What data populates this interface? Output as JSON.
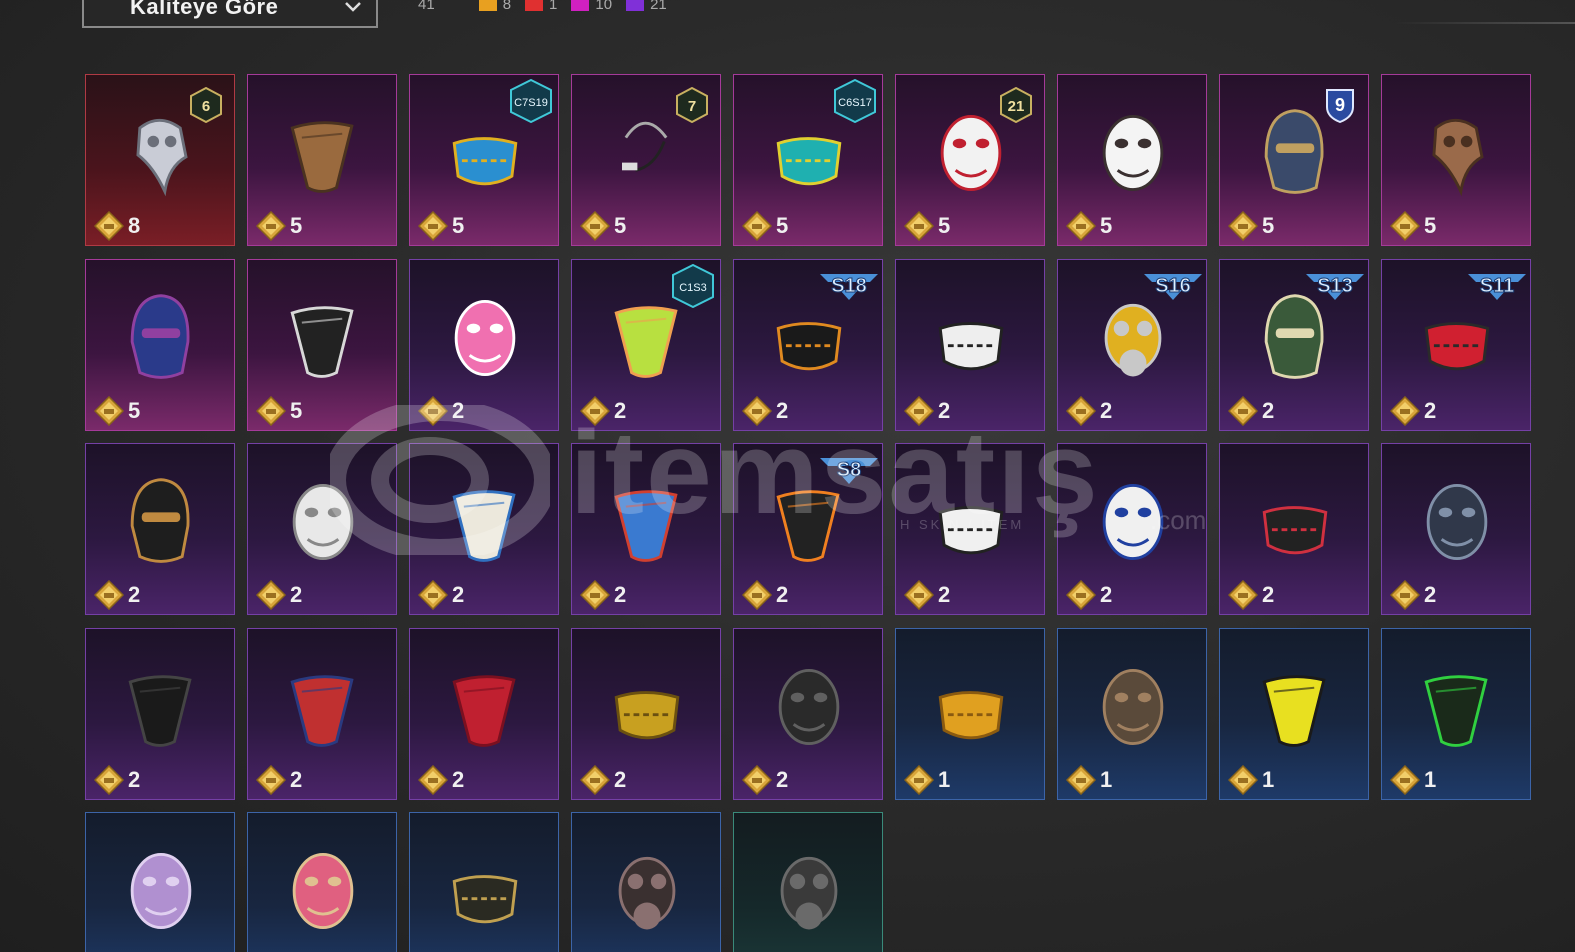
{
  "header": {
    "sort_label": "Kaliteye Göre",
    "total_count": "41",
    "rarity_counts": [
      {
        "color": "#e8a020",
        "value": "8"
      },
      {
        "color": "#e03030",
        "value": "1"
      },
      {
        "color": "#d020c0",
        "value": "10"
      },
      {
        "color": "#8030d8",
        "value": "21"
      }
    ]
  },
  "watermark": {
    "text": "itemsatış",
    "sub": "H SKIN / ITEM",
    "suffix": ".com"
  },
  "items": [
    {
      "price": "8",
      "rarity": "red",
      "badge": "6",
      "badge_type": "num",
      "icon": "plague-doctor-mask-icon"
    },
    {
      "price": "5",
      "rarity": "pink",
      "icon": "brown-bandana-icon"
    },
    {
      "price": "5",
      "rarity": "pink",
      "badge": "C7S19",
      "badge_type": "hex",
      "icon": "aztec-face-mask-icon"
    },
    {
      "price": "5",
      "rarity": "pink",
      "badge": "7",
      "badge_type": "num",
      "icon": "headset-mic-icon"
    },
    {
      "price": "5",
      "rarity": "pink",
      "badge": "C6S17",
      "badge_type": "hex",
      "icon": "teal-face-mask-icon"
    },
    {
      "price": "5",
      "rarity": "pink",
      "badge": "21",
      "badge_type": "num",
      "icon": "joker-mask-icon"
    },
    {
      "price": "5",
      "rarity": "pink",
      "icon": "white-cloth-mask-icon"
    },
    {
      "price": "5",
      "rarity": "pink",
      "badge": "9",
      "badge_type": "shield",
      "icon": "knight-helmet-icon"
    },
    {
      "price": "5",
      "rarity": "pink",
      "icon": "bronze-beak-mask-icon"
    },
    {
      "price": "5",
      "rarity": "pink",
      "icon": "galaxy-helmet-icon"
    },
    {
      "price": "5",
      "rarity": "pink",
      "icon": "skull-bandana-icon"
    },
    {
      "price": "2",
      "rarity": "purple",
      "icon": "pink-cartoon-mask-icon"
    },
    {
      "price": "2",
      "rarity": "purple",
      "badge": "C1S3",
      "badge_type": "hex",
      "icon": "cactus-bandana-icon"
    },
    {
      "price": "2",
      "rarity": "purple",
      "badge": "S18",
      "badge_type": "season",
      "icon": "heartbeat-mask-icon"
    },
    {
      "price": "2",
      "rarity": "purple",
      "icon": "skull-face-mask-icon"
    },
    {
      "price": "2",
      "rarity": "purple",
      "badge": "S16",
      "badge_type": "season",
      "icon": "visor-respirator-icon"
    },
    {
      "price": "2",
      "rarity": "purple",
      "badge": "S13",
      "badge_type": "season",
      "icon": "goggle-helmet-icon"
    },
    {
      "price": "2",
      "rarity": "purple",
      "badge": "S11",
      "badge_type": "season",
      "icon": "red-half-mask-icon"
    },
    {
      "price": "2",
      "rarity": "purple",
      "icon": "ninja-hood-icon"
    },
    {
      "price": "2",
      "rarity": "purple",
      "icon": "bandage-mask-icon"
    },
    {
      "price": "2",
      "rarity": "purple",
      "icon": "white-bandana-icon"
    },
    {
      "price": "2",
      "rarity": "purple",
      "icon": "blue-bandana-icon"
    },
    {
      "price": "2",
      "rarity": "purple",
      "badge": "S8",
      "badge_type": "season",
      "icon": "flame-bandana-icon"
    },
    {
      "price": "2",
      "rarity": "purple",
      "icon": "skull-print-mask-icon"
    },
    {
      "price": "2",
      "rarity": "purple",
      "icon": "hockey-mask-icon"
    },
    {
      "price": "2",
      "rarity": "purple",
      "icon": "shark-teeth-mask-icon"
    },
    {
      "price": "2",
      "rarity": "purple",
      "icon": "iron-skull-mask-icon"
    },
    {
      "price": "2",
      "rarity": "purple",
      "icon": "black-bandana-icon"
    },
    {
      "price": "2",
      "rarity": "purple",
      "icon": "flag-bandana-icon"
    },
    {
      "price": "2",
      "rarity": "purple",
      "icon": "red-neckerchief-icon"
    },
    {
      "price": "2",
      "rarity": "purple",
      "icon": "gold-sequin-mask-icon"
    },
    {
      "price": "2",
      "rarity": "purple",
      "icon": "black-combat-mask-icon"
    },
    {
      "price": "1",
      "rarity": "blue",
      "icon": "golden-face-mask-icon"
    },
    {
      "price": "1",
      "rarity": "blue",
      "icon": "rusty-metal-mask-icon"
    },
    {
      "price": "1",
      "rarity": "blue",
      "icon": "yellow-dot-bandana-icon"
    },
    {
      "price": "1",
      "rarity": "blue",
      "icon": "green-web-bandana-icon"
    },
    {
      "price": "",
      "rarity": "blue",
      "icon": "purple-smile-mask-icon"
    },
    {
      "price": "",
      "rarity": "blue",
      "icon": "pink-smile-mask-icon"
    },
    {
      "price": "",
      "rarity": "blue",
      "icon": "tribal-face-mask-icon"
    },
    {
      "price": "",
      "rarity": "blue",
      "icon": "respirator-icon"
    },
    {
      "price": "",
      "rarity": "green",
      "icon": "gas-mask-icon"
    }
  ]
}
